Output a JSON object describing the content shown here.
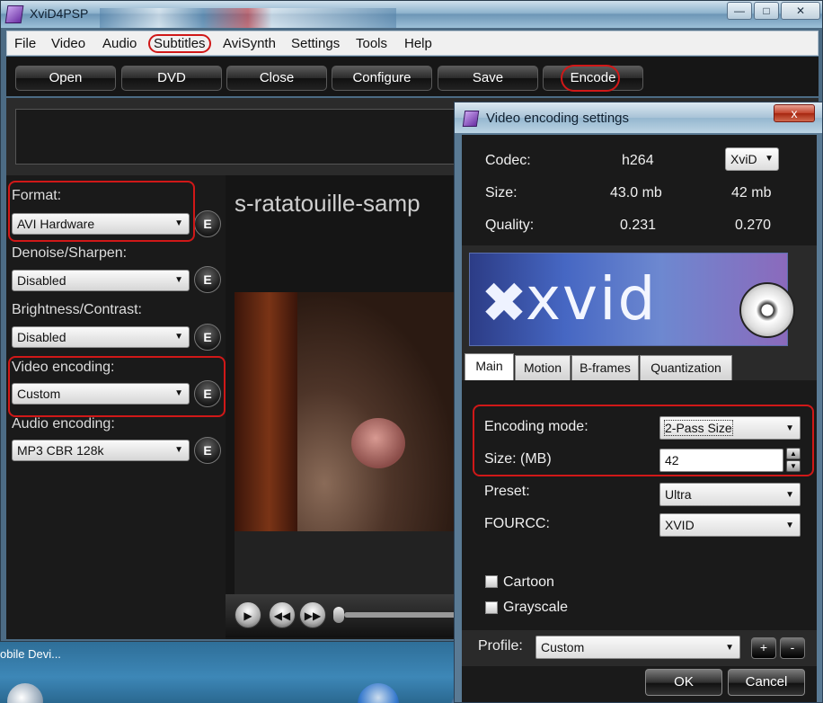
{
  "window": {
    "title": "XviD4PSP"
  },
  "menu": [
    "File",
    "Video",
    "Audio",
    "Subtitles",
    "AviSynth",
    "Settings",
    "Tools",
    "Help"
  ],
  "toolbar": [
    "Open",
    "DVD",
    "Close",
    "Configure",
    "Save",
    "Encode"
  ],
  "left_panel": {
    "format_label": "Format:",
    "format_value": "AVI Hardware",
    "denoise_label": "Denoise/Sharpen:",
    "denoise_value": "Disabled",
    "brightness_label": "Brightness/Contrast:",
    "brightness_value": "Disabled",
    "video_label": "Video encoding:",
    "video_value": "Custom",
    "audio_label": "Audio encoding:",
    "audio_value": "MP3 CBR 128k",
    "edit_label": "E"
  },
  "video": {
    "title": "s-ratatouille-samp"
  },
  "desktop": {
    "label": "obile Devi..."
  },
  "dialog": {
    "title": "Video encoding settings",
    "close_label": "x",
    "codec_label": "Codec:",
    "codec_value": "h264",
    "codec_select": "XviD",
    "size_label": "Size:",
    "size_value": "43.0 mb",
    "size_target": "42 mb",
    "quality_label": "Quality:",
    "quality_value": "0.231",
    "quality_target": "0.270",
    "logo_text": "xvid",
    "tabs": [
      "Main",
      "Motion",
      "B-frames",
      "Quantization"
    ],
    "encoding_mode_label": "Encoding mode:",
    "encoding_mode_value": "2-Pass Size",
    "size_mb_label": "Size: (MB)",
    "size_mb_value": "42",
    "preset_label": "Preset:",
    "preset_value": "Ultra",
    "fourcc_label": "FOURCC:",
    "fourcc_value": "XVID",
    "cartoon_label": "Cartoon",
    "grayscale_label": "Grayscale",
    "profile_label": "Profile:",
    "profile_value": "Custom",
    "plus_label": "+",
    "minus_label": "-",
    "ok_label": "OK",
    "cancel_label": "Cancel"
  }
}
